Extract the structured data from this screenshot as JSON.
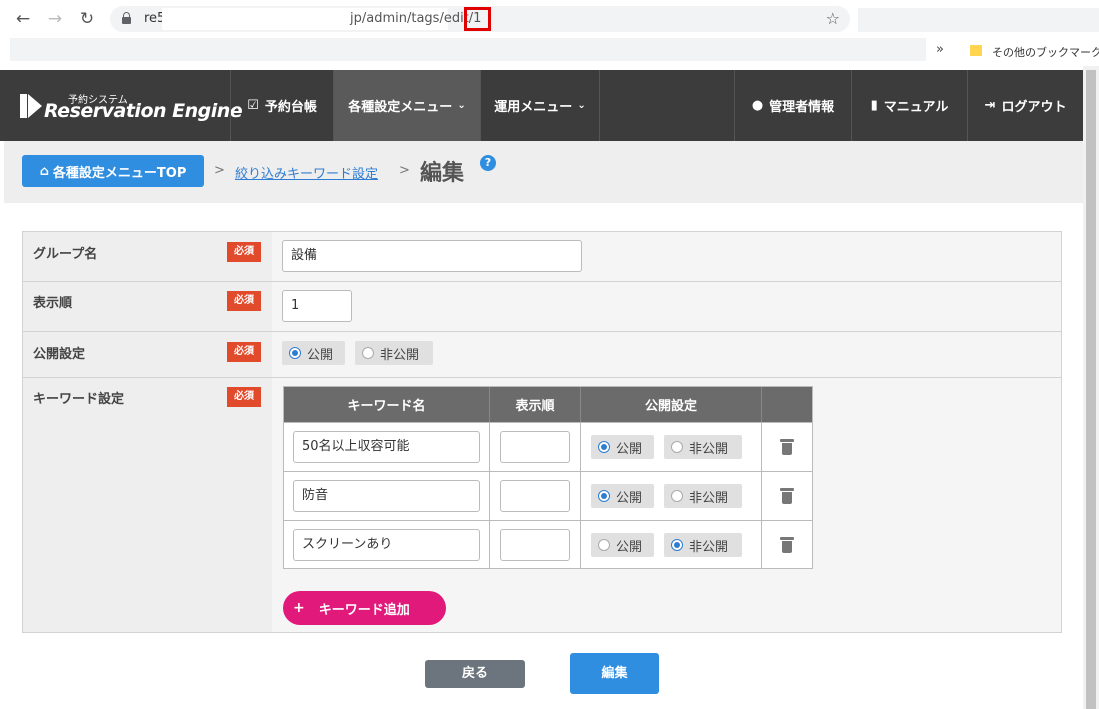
{
  "browser": {
    "url_host": "re5",
    "url_path": "jp/admin/tags/edit/1",
    "bookmarks_more": "»",
    "bookmark_folder": "その他のブックマーク"
  },
  "header": {
    "logo_sub": "予約システム",
    "logo_main": "Reservation Engine",
    "nav": [
      {
        "label": "予約台帳",
        "icon": "clipboard-check-icon",
        "active": false
      },
      {
        "label": "各種設定メニュー",
        "icon": "chevron-down-icon",
        "active": true
      },
      {
        "label": "運用メニュー",
        "icon": "chevron-down-icon",
        "active": false
      },
      {
        "label": "管理者情報",
        "icon": "user-icon",
        "active": false
      },
      {
        "label": "マニュアル",
        "icon": "book-icon",
        "active": false
      },
      {
        "label": "ログアウト",
        "icon": "logout-icon",
        "active": false
      }
    ]
  },
  "breadcrumb": {
    "home": "各種設定メニューTOP",
    "sep": ">",
    "link": "絞り込みキーワード設定",
    "current": "編集",
    "help": "?"
  },
  "form": {
    "required_label": "必須",
    "group_name": {
      "label": "グループ名",
      "value": "設備"
    },
    "display_order": {
      "label": "表示順",
      "value": "1"
    },
    "publish": {
      "label": "公開設定",
      "options": [
        "公開",
        "非公開"
      ],
      "selected": "公開"
    },
    "keywords": {
      "label": "キーワード設定",
      "columns": [
        "キーワード名",
        "表示順",
        "公開設定"
      ],
      "rows": [
        {
          "name": "50名以上収容可能",
          "order": "",
          "selected": "公開"
        },
        {
          "name": "防音",
          "order": "",
          "selected": "公開"
        },
        {
          "name": "スクリーンあり",
          "order": "",
          "selected": "非公開"
        }
      ],
      "option_public": "公開",
      "option_private": "非公開",
      "add_plus": "+",
      "add_label": "キーワード追加"
    }
  },
  "actions": {
    "back": "戻る",
    "submit": "編集"
  },
  "colors": {
    "header_bg": "#3c3c3c",
    "primary": "#2f8ee0",
    "required": "#e24a2c",
    "add_button": "#e0197a",
    "back_button": "#6c757d"
  }
}
